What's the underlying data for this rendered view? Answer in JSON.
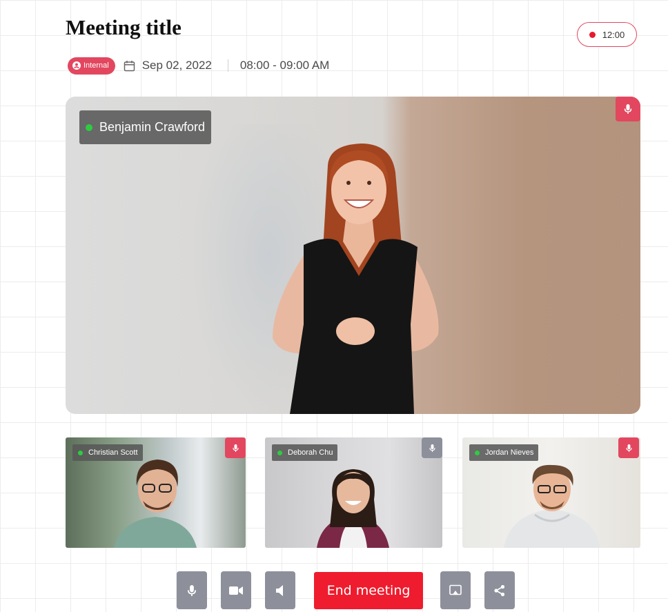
{
  "meeting": {
    "title": "Meeting title",
    "badge": "Internal",
    "date": "Sep 02, 2022",
    "time": "08:00 - 09:00 AM",
    "recording_time": "12:00"
  },
  "main_speaker": {
    "name": "Benjamin Crawford",
    "mic": "on"
  },
  "participants": [
    {
      "name": "Christian Scott",
      "mic": "on"
    },
    {
      "name": "Deborah Chu",
      "mic": "muted"
    },
    {
      "name": "Jordan Nieves",
      "mic": "on"
    }
  ],
  "controls": {
    "end_label": "End meeting"
  },
  "colors": {
    "accent_pink": "#e2475f",
    "end_red": "#ee1c2e",
    "control_gray": "#8d909a",
    "online_green": "#2ecc40"
  },
  "icons": [
    "record-dot-icon",
    "user-circle-icon",
    "calendar-icon",
    "online-dot-icon",
    "microphone-icon",
    "video-camera-icon",
    "speaker-icon",
    "screen-share-icon",
    "share-icon"
  ]
}
